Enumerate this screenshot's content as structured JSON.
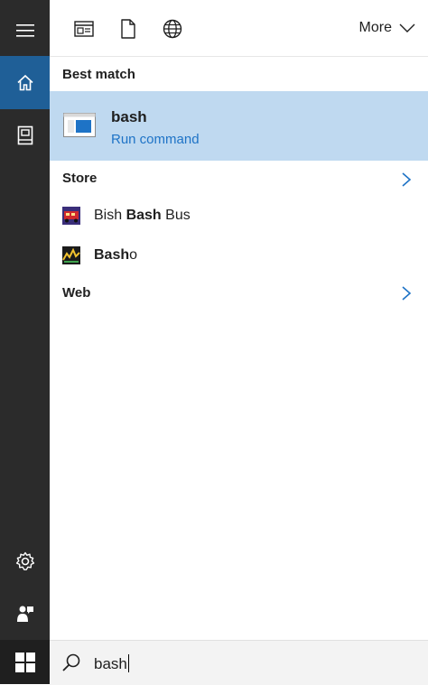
{
  "sidebar": {
    "items": [
      {
        "icon": "hamburger-menu-icon"
      },
      {
        "icon": "home-icon",
        "selected": true
      },
      {
        "icon": "notebook-icon"
      },
      {
        "icon": "gear-icon"
      },
      {
        "icon": "feedback-icon"
      },
      {
        "icon": "windows-logo-icon"
      }
    ],
    "accent_color": "#1f5f97"
  },
  "topbar": {
    "filters": [
      {
        "icon": "apps-filter-icon"
      },
      {
        "icon": "documents-filter-icon"
      },
      {
        "icon": "web-globe-icon"
      }
    ],
    "more_label": "More"
  },
  "results": {
    "best_match": {
      "header": "Best match",
      "title": "bash",
      "subtitle": "Run command",
      "highlight_color": "#bfd9f0"
    },
    "store": {
      "header": "Store",
      "items": [
        {
          "prefix": "Bish ",
          "match": "Bash",
          "suffix": " Bus"
        },
        {
          "prefix": "",
          "match": "Bash",
          "suffix": "o"
        }
      ]
    },
    "web": {
      "header": "Web"
    }
  },
  "search": {
    "value": "bash"
  }
}
